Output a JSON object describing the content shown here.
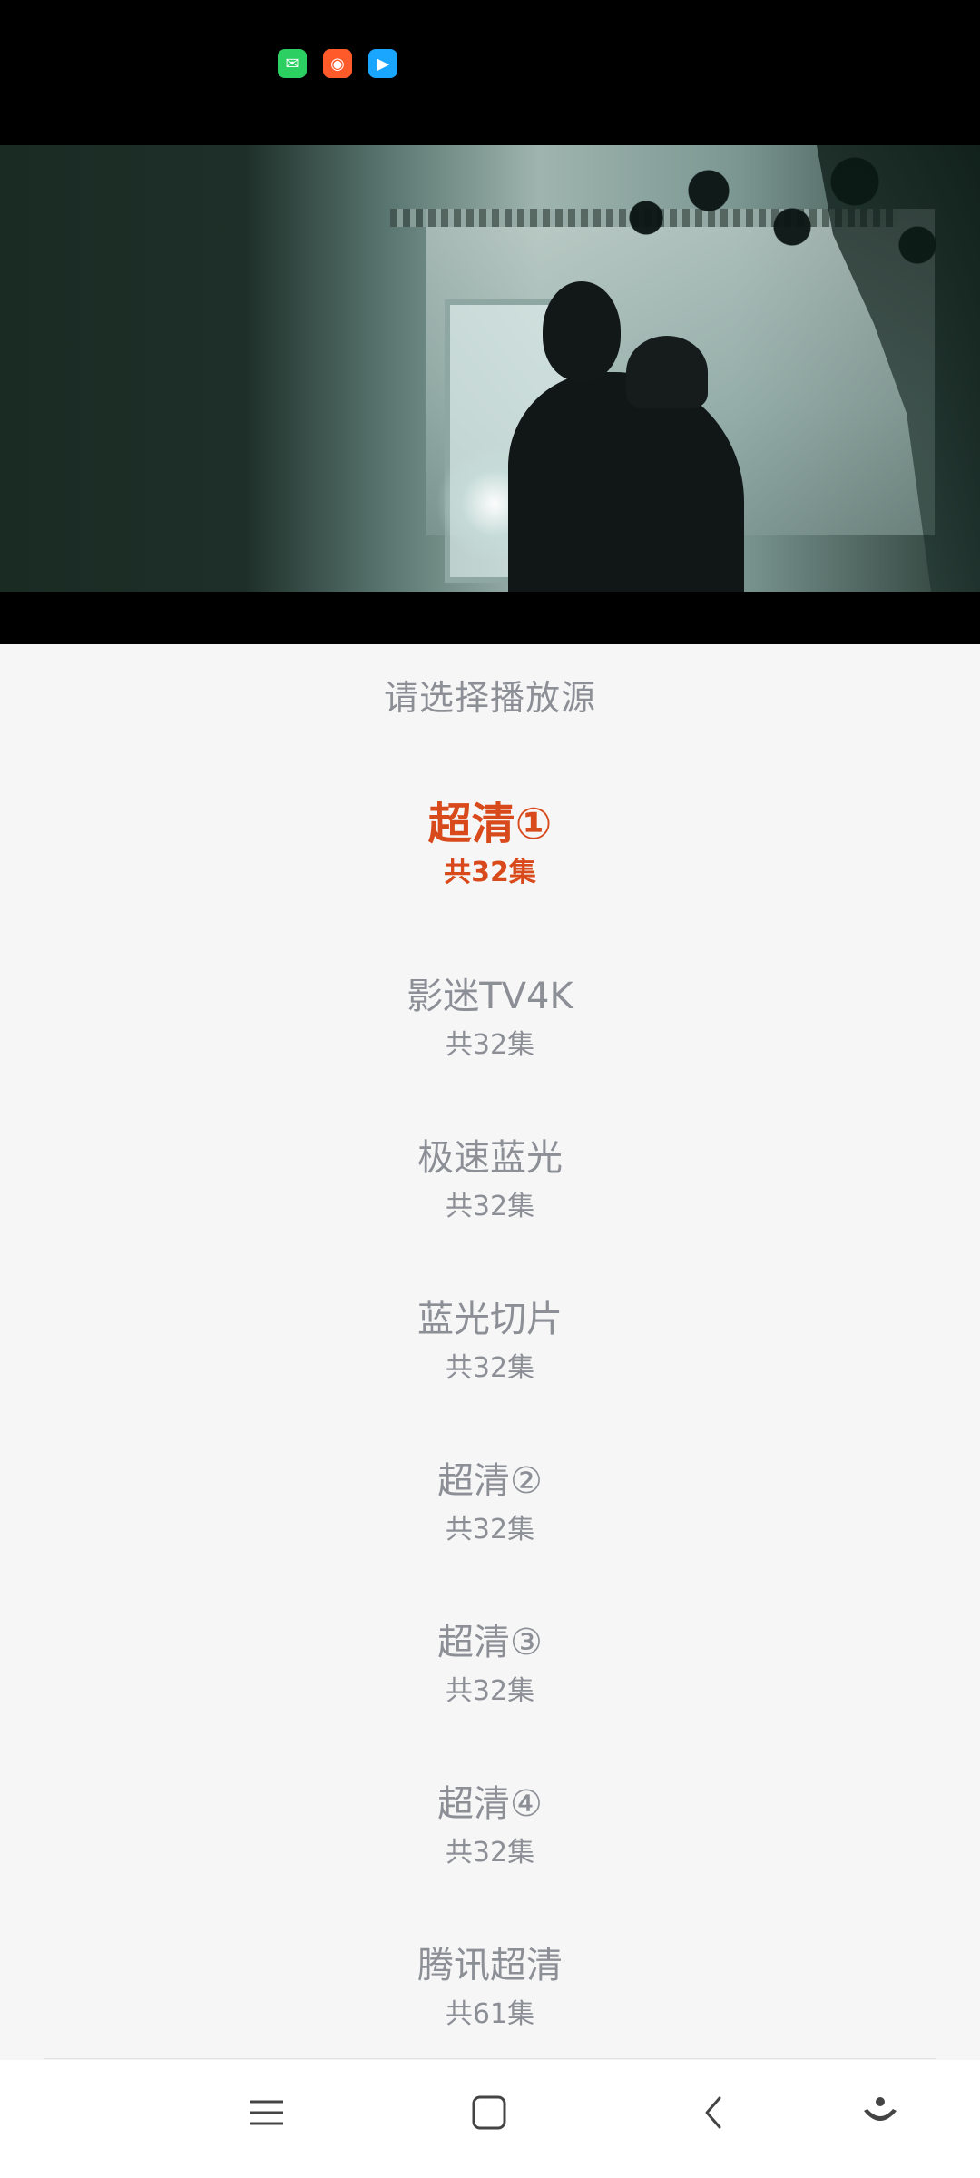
{
  "status_bar": {
    "icons": [
      "wechat-icon",
      "kuaishou-icon",
      "video-app-icon"
    ]
  },
  "panel": {
    "title": "请选择播放源"
  },
  "sources": [
    {
      "name": "超清①",
      "count": "共32集",
      "selected": true
    },
    {
      "name": "影迷TV4K",
      "count": "共32集",
      "selected": false
    },
    {
      "name": "极速蓝光",
      "count": "共32集",
      "selected": false
    },
    {
      "name": "蓝光切片",
      "count": "共32集",
      "selected": false
    },
    {
      "name": "超清②",
      "count": "共32集",
      "selected": false
    },
    {
      "name": "超清③",
      "count": "共32集",
      "selected": false
    },
    {
      "name": "超清④",
      "count": "共32集",
      "selected": false
    },
    {
      "name": "腾讯超清",
      "count": "共61集",
      "selected": false
    }
  ],
  "nav_bar": {
    "icons": [
      "menu-icon",
      "home-icon",
      "back-icon",
      "assistant-icon"
    ]
  },
  "colors": {
    "accent": "#d84a1b",
    "text_muted": "#8c8f96",
    "background": "#f6f6f6"
  }
}
